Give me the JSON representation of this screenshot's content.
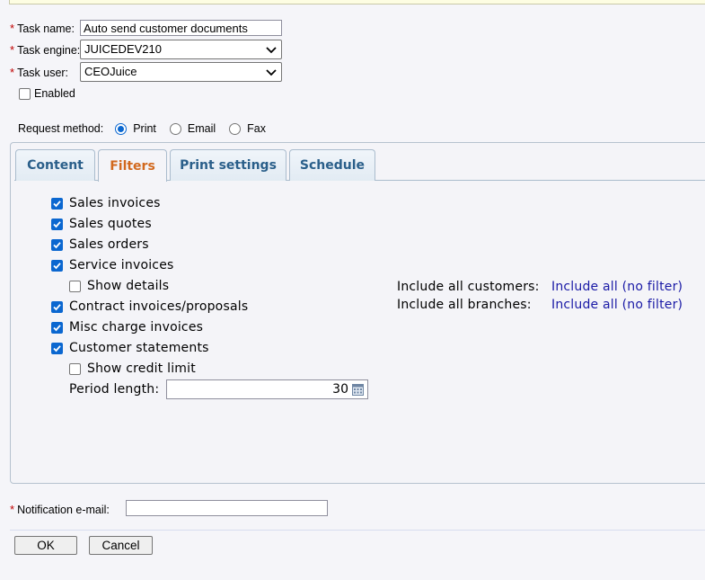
{
  "form": {
    "task_name": {
      "label": "Task name:",
      "value": "Auto send customer documents"
    },
    "task_engine": {
      "label": "Task engine:",
      "value": "JUICEDEV210"
    },
    "task_user": {
      "label": "Task user:",
      "value": "CEOJuice"
    },
    "enabled": {
      "label": "Enabled",
      "checked": false
    },
    "request_method": {
      "label": "Request method:",
      "options": [
        {
          "label": "Print",
          "selected": true
        },
        {
          "label": "Email",
          "selected": false
        },
        {
          "label": "Fax",
          "selected": false
        }
      ]
    },
    "required_marker": "*"
  },
  "tabs": [
    {
      "label": "Content",
      "active": false
    },
    {
      "label": "Filters",
      "active": true
    },
    {
      "label": "Print settings",
      "active": false
    },
    {
      "label": "Schedule",
      "active": false
    }
  ],
  "filters": {
    "items": [
      {
        "label": "Sales invoices",
        "checked": true
      },
      {
        "label": "Sales quotes",
        "checked": true
      },
      {
        "label": "Sales orders",
        "checked": true
      },
      {
        "label": "Service invoices",
        "checked": true
      },
      {
        "label": "Show details",
        "checked": false
      },
      {
        "label": "Contract invoices/proposals",
        "checked": true
      },
      {
        "label": "Misc charge invoices",
        "checked": true
      },
      {
        "label": "Customer statements",
        "checked": true
      },
      {
        "label": "Show credit limit",
        "checked": false
      }
    ],
    "period_length": {
      "label": "Period length:",
      "value": "30"
    },
    "customers": {
      "label": "Include all customers:",
      "link": "Include all (no filter)"
    },
    "branches": {
      "label": "Include all branches:",
      "link": "Include all (no filter)"
    }
  },
  "notification": {
    "label": "Notification e-mail:",
    "value": ""
  },
  "buttons": {
    "ok": "OK",
    "cancel": "Cancel"
  },
  "colors": {
    "accent": "#0b67d0",
    "active_tab": "#d2691e",
    "tab_text": "#2a5f8a",
    "link": "#1a1aa6",
    "required": "#c00000"
  }
}
